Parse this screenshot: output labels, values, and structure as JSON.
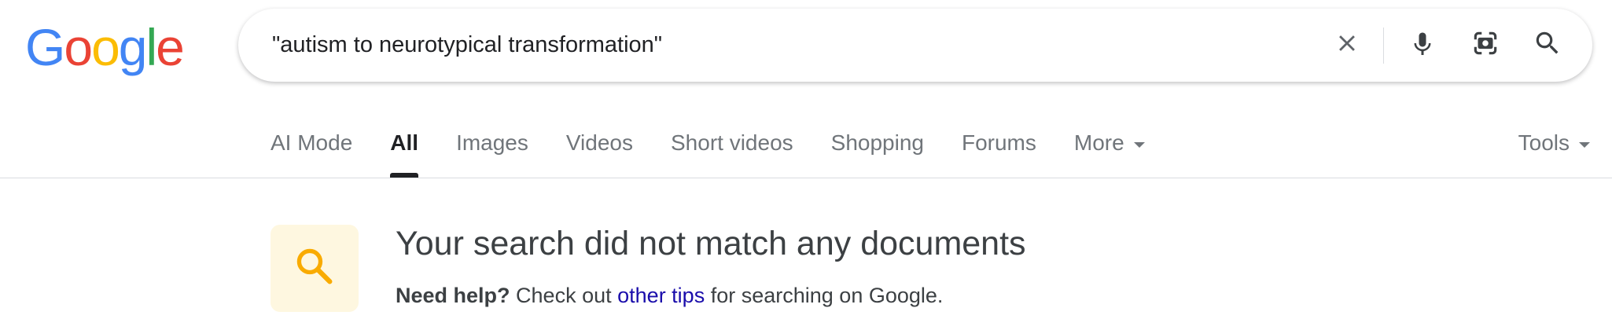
{
  "logo": {
    "letters": [
      "G",
      "o",
      "o",
      "g",
      "l",
      "e"
    ],
    "colors": [
      "#4285F4",
      "#EA4335",
      "#FBBC05",
      "#4285F4",
      "#34A853",
      "#EA4335"
    ]
  },
  "search": {
    "query": "\"autism to neurotypical transformation\"",
    "icons": {
      "clear": "close-icon",
      "voice": "microphone-icon",
      "lens": "camera-lens-icon",
      "submit": "search-icon"
    }
  },
  "tabs": [
    {
      "label": "AI Mode",
      "active": false
    },
    {
      "label": "All",
      "active": true
    },
    {
      "label": "Images",
      "active": false
    },
    {
      "label": "Videos",
      "active": false
    },
    {
      "label": "Short videos",
      "active": false
    },
    {
      "label": "Shopping",
      "active": false
    },
    {
      "label": "Forums",
      "active": false
    },
    {
      "label": "More",
      "active": false
    }
  ],
  "tools": {
    "label": "Tools"
  },
  "no_results": {
    "title": "Your search did not match any documents",
    "help_bold": "Need help?",
    "help_pre": "Check out",
    "help_link": "other tips",
    "help_post": "for searching on Google.",
    "icon": "magnifier-icon",
    "icon_color": "#F9AB00",
    "icon_bg": "#FEF7E0",
    "link_color": "#1A0DAB"
  }
}
